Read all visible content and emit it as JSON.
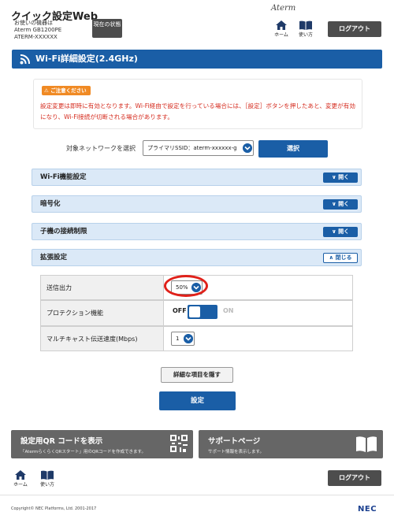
{
  "header": {
    "app_title": "クイック設定Web",
    "device_line1": "お使いの機器は",
    "device_line2": "Aterm GB1200PE",
    "device_line3": "ATERM-XXXXXX",
    "status_button": "現在の状態",
    "brand": "Aterm",
    "home_label": "ホーム",
    "help_label": "使い方",
    "logout": "ログアウト"
  },
  "page_title": "Wi-Fi詳細設定(2.4GHz)",
  "notice": {
    "badge": "ご注意ください",
    "text": "設定変更は即時に有効となります。Wi-Fi経由で設定を行っている場合には、［設定］ボタンを押したあと、変更が有効になり、Wi-Fi接続が切断される場合があります。"
  },
  "network_select": {
    "label": "対象ネットワークを選択",
    "value": "プライマリSSID：aterm-xxxxxx-g",
    "button": "選択"
  },
  "sections": [
    {
      "title": "Wi-Fi機能設定",
      "toggle": "開く"
    },
    {
      "title": "暗号化",
      "toggle": "開く"
    },
    {
      "title": "子機の接続制限",
      "toggle": "開く"
    },
    {
      "title": "拡張設定",
      "toggle": "閉じる"
    }
  ],
  "extended": {
    "tx_power_label": "送信出力",
    "tx_power_value": "50%",
    "protection_label": "プロテクション機能",
    "protection_off": "OFF",
    "protection_on": "ON",
    "multicast_label": "マルチキャスト伝送速度(Mbps)",
    "multicast_value": "1"
  },
  "buttons": {
    "hide_details": "詳細な項目を隠す",
    "apply": "設定"
  },
  "panels": {
    "qr_title": "設定用QR コードを表示",
    "qr_sub": "「AtermらくらくQRスタート」用のQRコードを作成できます。",
    "support_title": "サポートページ",
    "support_sub": "サポート情報を表示します。"
  },
  "footer": {
    "home_label": "ホーム",
    "help_label": "使い方",
    "logout": "ログアウト",
    "copyright": "Copyright© NEC Platforms, Ltd. 2001-2017",
    "nec_logo": "NEC"
  },
  "colors": {
    "primary": "#1a5ea6",
    "accent_header": "#dbe9f7",
    "warning": "#d52b1e",
    "badge": "#f08a24",
    "highlight": "#e0211a"
  }
}
